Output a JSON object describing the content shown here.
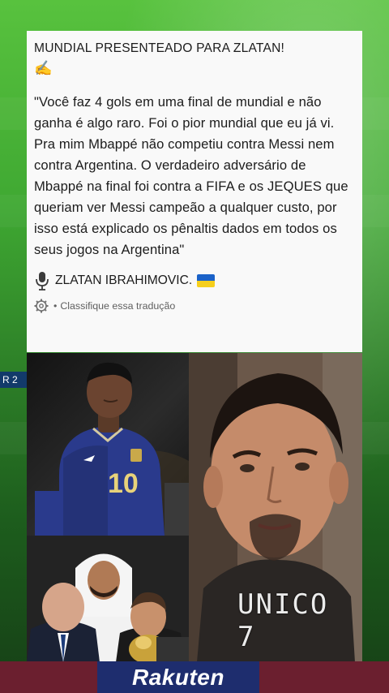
{
  "background": {
    "pitch_color": "#3fa832",
    "scoreboard_text": "R 2"
  },
  "post": {
    "headline": "MUNDIAL PRESENTEADO PARA ZLATAN!",
    "headline_icon": "writing-hand-emoji",
    "quote": "\"Você faz 4 gols em uma final de mundial e não ganha é algo raro. Foi o pior mundial que eu já vi. Pra mim Mbappé não competiu contra Messi nem contra Argentina. O verdadeiro adversário de Mbappé na final foi contra a FIFA e os JEQUES que queriam ver Messi campeão a qualquer custo, por isso está explicado os pênaltis dados em todos os seus jogos na Argentina\"",
    "author_icon": "microphone-icon",
    "author": "ZLATAN IBRAHIMOVIC.",
    "author_flag": "ukraine-flag-icon",
    "translate_icon": "gear-icon",
    "translate_separator": "•",
    "translate_label": "Classifique essa tradução"
  },
  "photos": {
    "mbappe_number": "10",
    "zlatan_watermark": "UNICO 7"
  },
  "sponsor": {
    "text": "Rakuten"
  },
  "colors": {
    "card_bg": "#f9f9f9",
    "text": "#1c1c1c",
    "muted": "#606060",
    "france_blue": "#2a3a8c",
    "ukraine_blue": "#1b62c8",
    "ukraine_yellow": "#f6cf1d",
    "barca_blue": "#1e2d6e",
    "barca_red": "#6b1f2f"
  }
}
